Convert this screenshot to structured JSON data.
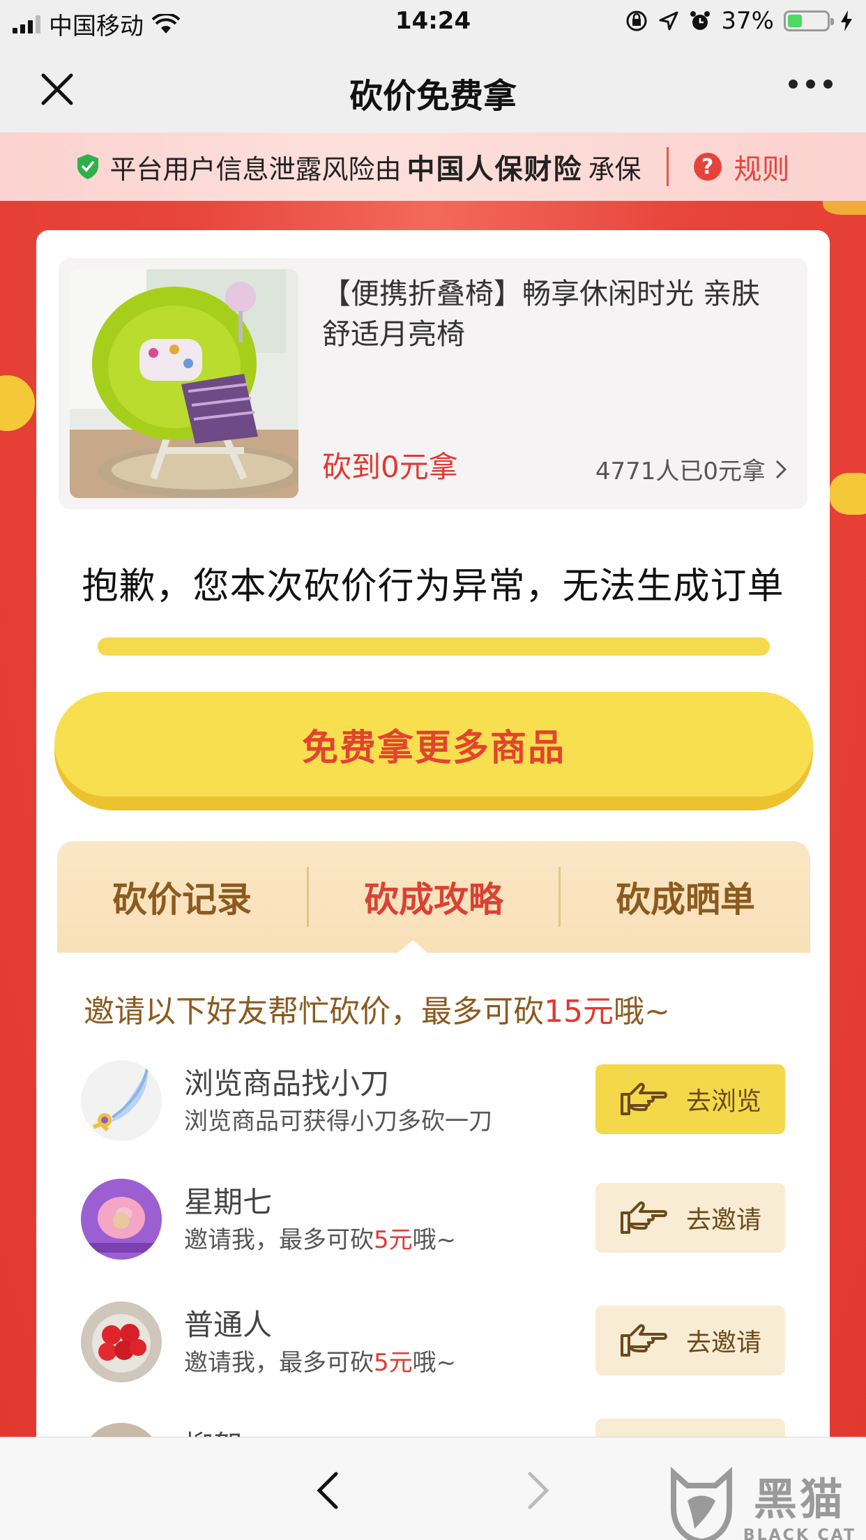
{
  "status_bar": {
    "carrier": "中国移动",
    "time": "14:24",
    "battery_percent": "37%",
    "battery_level": 0.37
  },
  "nav": {
    "title": "砍价免费拿"
  },
  "notice": {
    "prefix": "平台用户信息泄露风险由",
    "brand": "中国人保财险",
    "suffix": "承保",
    "rule_label": "规则",
    "rule_icon_text": "?"
  },
  "product": {
    "title": "【便携折叠椅】畅享休闲时光 亲肤舒适月亮椅",
    "price_text": "砍到0元拿",
    "count_text": "4771人已0元拿"
  },
  "message": "抱歉，您本次砍价行为异常，无法生成订单",
  "main_button": "免费拿更多商品",
  "tabs": [
    {
      "label": "砍价记录",
      "active": false
    },
    {
      "label": "砍成攻略",
      "active": true
    },
    {
      "label": "砍成晒单",
      "active": false
    }
  ],
  "invite": {
    "prefix": "邀请以下好友帮忙砍价，最多可砍",
    "amount": "15元",
    "suffix": "哦~"
  },
  "rows": [
    {
      "name": "浏览商品找小刀",
      "desc_prefix": "浏览商品可获得小刀多砍一刀",
      "desc_amount": "",
      "desc_suffix": "",
      "button": "去浏览"
    },
    {
      "name": "星期七",
      "desc_prefix": "邀请我，最多可砍",
      "desc_amount": "5元",
      "desc_suffix": "哦~",
      "button": "去邀请"
    },
    {
      "name": "普通人",
      "desc_prefix": "邀请我，最多可砍",
      "desc_amount": "5元",
      "desc_suffix": "哦~",
      "button": "去邀请"
    },
    {
      "name": "柳絮"
    }
  ],
  "watermark": {
    "cn": "黑猫",
    "en": "BLACK CAT"
  },
  "colors": {
    "accent_red": "#e1392f",
    "button_yellow": "#f7df50",
    "tab_brown": "#8b5a1e"
  }
}
